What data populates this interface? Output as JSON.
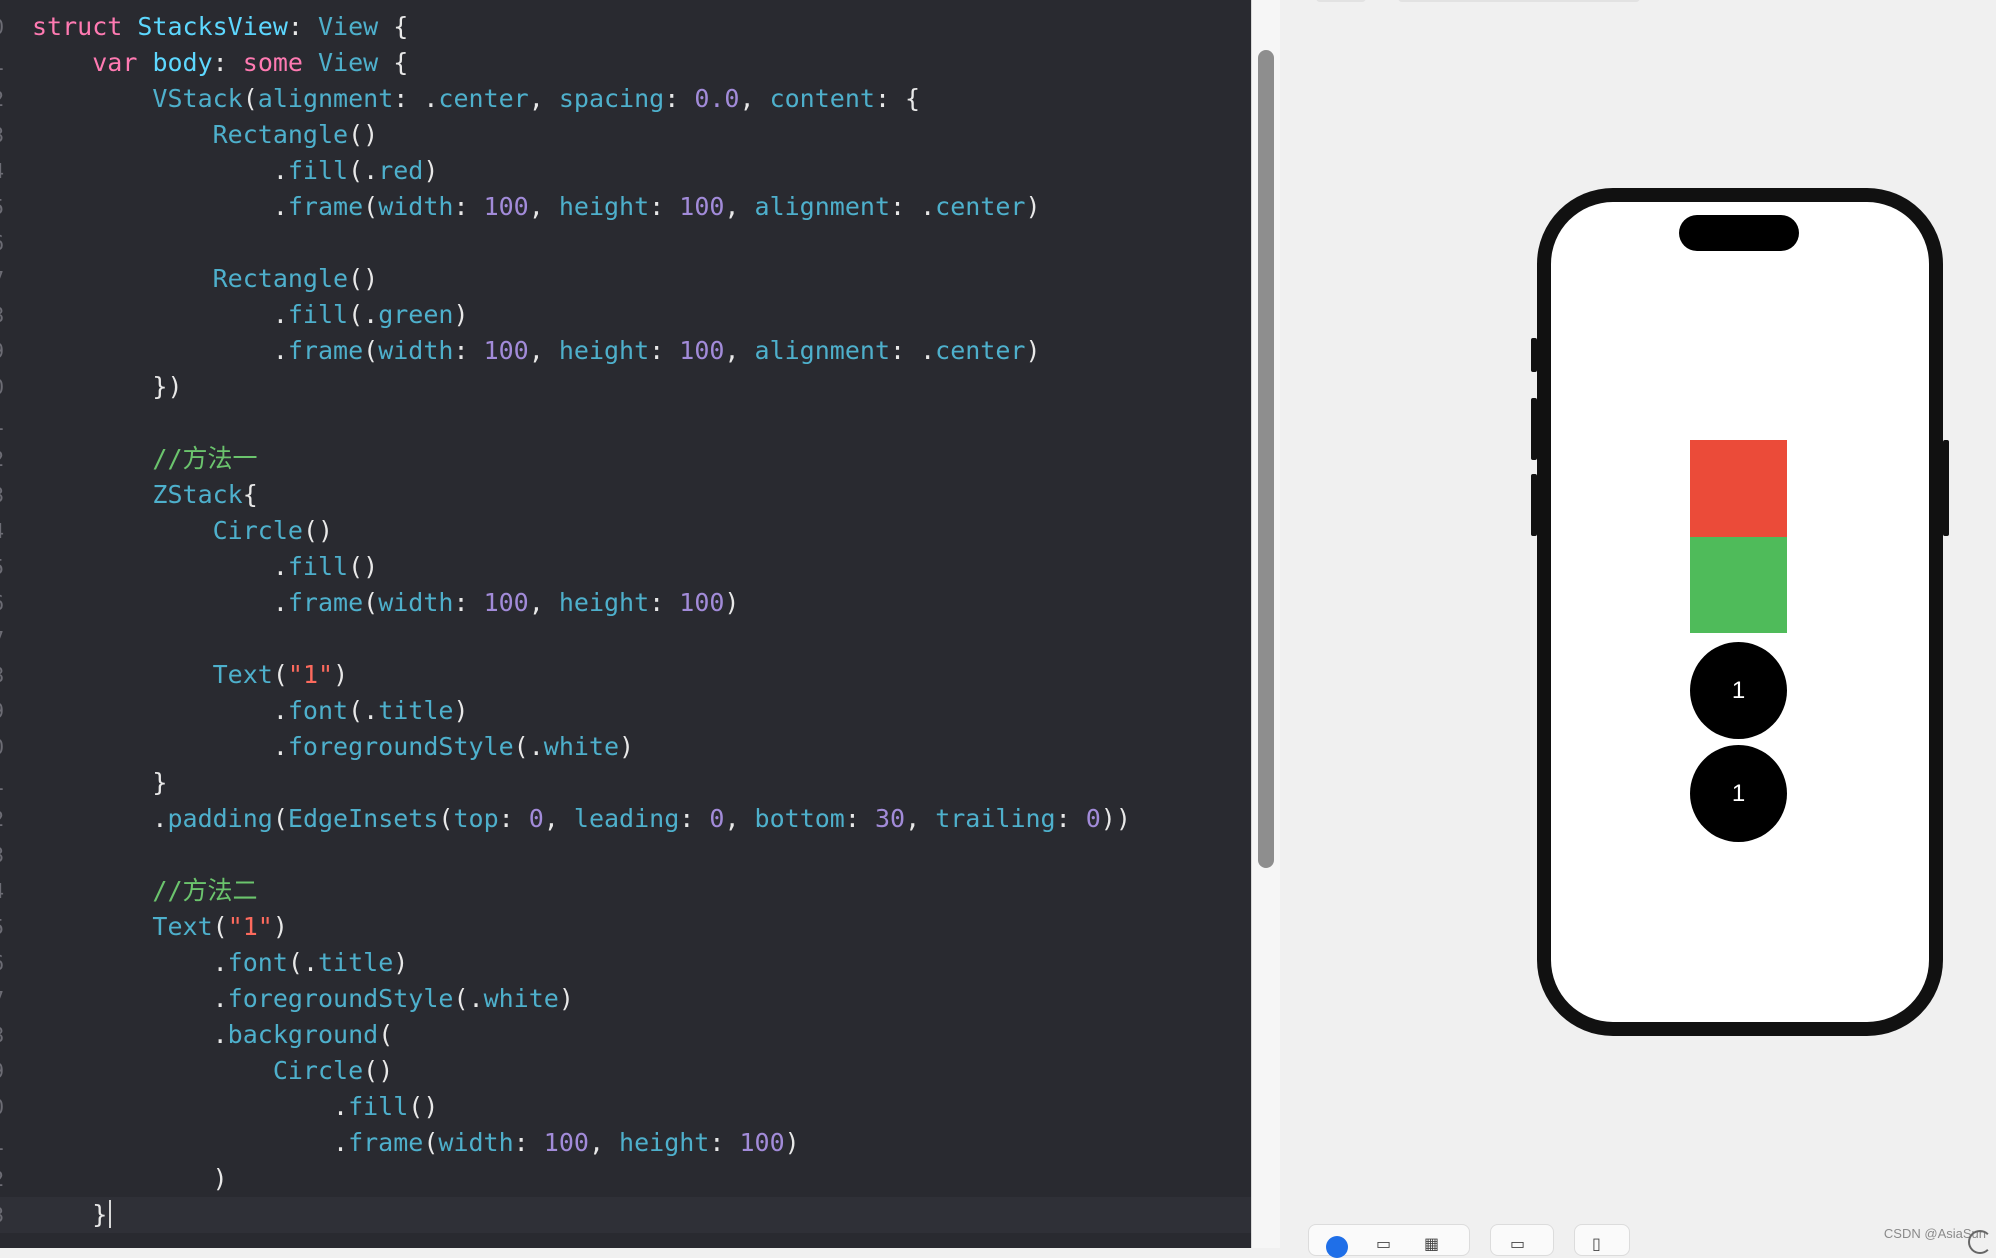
{
  "editor": {
    "lines": [
      [
        [
          "kw",
          "struct "
        ],
        [
          "ty2",
          "StacksView"
        ],
        [
          "pl",
          ": "
        ],
        [
          "fn",
          "View"
        ],
        [
          "pl",
          " {"
        ]
      ],
      [
        [
          "pl",
          "    "
        ],
        [
          "kw",
          "var "
        ],
        [
          "ty2",
          "body"
        ],
        [
          "pl",
          ": "
        ],
        [
          "kw",
          "some "
        ],
        [
          "fn",
          "View"
        ],
        [
          "pl",
          " {"
        ]
      ],
      [
        [
          "pl",
          "        "
        ],
        [
          "fn",
          "VStack"
        ],
        [
          "pl",
          "("
        ],
        [
          "fn",
          "alignment"
        ],
        [
          "pl",
          ": ."
        ],
        [
          "fn",
          "center"
        ],
        [
          "pl",
          ", "
        ],
        [
          "fn",
          "spacing"
        ],
        [
          "pl",
          ": "
        ],
        [
          "num",
          "0.0"
        ],
        [
          "pl",
          ", "
        ],
        [
          "fn",
          "content"
        ],
        [
          "pl",
          ": {"
        ]
      ],
      [
        [
          "pl",
          "            "
        ],
        [
          "fn",
          "Rectangle"
        ],
        [
          "pl",
          "()"
        ]
      ],
      [
        [
          "pl",
          "                ."
        ],
        [
          "fn",
          "fill"
        ],
        [
          "pl",
          "(."
        ],
        [
          "fn",
          "red"
        ],
        [
          "pl",
          ")"
        ]
      ],
      [
        [
          "pl",
          "                ."
        ],
        [
          "fn",
          "frame"
        ],
        [
          "pl",
          "("
        ],
        [
          "fn",
          "width"
        ],
        [
          "pl",
          ": "
        ],
        [
          "num",
          "100"
        ],
        [
          "pl",
          ", "
        ],
        [
          "fn",
          "height"
        ],
        [
          "pl",
          ": "
        ],
        [
          "num",
          "100"
        ],
        [
          "pl",
          ", "
        ],
        [
          "fn",
          "alignment"
        ],
        [
          "pl",
          ": ."
        ],
        [
          "fn",
          "center"
        ],
        [
          "pl",
          ")"
        ]
      ],
      [
        [
          "pl",
          ""
        ]
      ],
      [
        [
          "pl",
          "            "
        ],
        [
          "fn",
          "Rectangle"
        ],
        [
          "pl",
          "()"
        ]
      ],
      [
        [
          "pl",
          "                ."
        ],
        [
          "fn",
          "fill"
        ],
        [
          "pl",
          "(."
        ],
        [
          "fn",
          "green"
        ],
        [
          "pl",
          ")"
        ]
      ],
      [
        [
          "pl",
          "                ."
        ],
        [
          "fn",
          "frame"
        ],
        [
          "pl",
          "("
        ],
        [
          "fn",
          "width"
        ],
        [
          "pl",
          ": "
        ],
        [
          "num",
          "100"
        ],
        [
          "pl",
          ", "
        ],
        [
          "fn",
          "height"
        ],
        [
          "pl",
          ": "
        ],
        [
          "num",
          "100"
        ],
        [
          "pl",
          ", "
        ],
        [
          "fn",
          "alignment"
        ],
        [
          "pl",
          ": ."
        ],
        [
          "fn",
          "center"
        ],
        [
          "pl",
          ")"
        ]
      ],
      [
        [
          "pl",
          "        })"
        ]
      ],
      [
        [
          "pl",
          ""
        ]
      ],
      [
        [
          "pl",
          "        "
        ],
        [
          "cm",
          "//方法一"
        ]
      ],
      [
        [
          "pl",
          "        "
        ],
        [
          "fn",
          "ZStack"
        ],
        [
          "pl",
          "{"
        ]
      ],
      [
        [
          "pl",
          "            "
        ],
        [
          "fn",
          "Circle"
        ],
        [
          "pl",
          "()"
        ]
      ],
      [
        [
          "pl",
          "                ."
        ],
        [
          "fn",
          "fill"
        ],
        [
          "pl",
          "()"
        ]
      ],
      [
        [
          "pl",
          "                ."
        ],
        [
          "fn",
          "frame"
        ],
        [
          "pl",
          "("
        ],
        [
          "fn",
          "width"
        ],
        [
          "pl",
          ": "
        ],
        [
          "num",
          "100"
        ],
        [
          "pl",
          ", "
        ],
        [
          "fn",
          "height"
        ],
        [
          "pl",
          ": "
        ],
        [
          "num",
          "100"
        ],
        [
          "pl",
          ")"
        ]
      ],
      [
        [
          "pl",
          ""
        ]
      ],
      [
        [
          "pl",
          "            "
        ],
        [
          "fn",
          "Text"
        ],
        [
          "pl",
          "("
        ],
        [
          "str",
          "\"1\""
        ],
        [
          "pl",
          ")"
        ]
      ],
      [
        [
          "pl",
          "                ."
        ],
        [
          "fn",
          "font"
        ],
        [
          "pl",
          "(."
        ],
        [
          "fn",
          "title"
        ],
        [
          "pl",
          ")"
        ]
      ],
      [
        [
          "pl",
          "                ."
        ],
        [
          "fn",
          "foregroundStyle"
        ],
        [
          "pl",
          "(."
        ],
        [
          "fn",
          "white"
        ],
        [
          "pl",
          ")"
        ]
      ],
      [
        [
          "pl",
          "        }"
        ]
      ],
      [
        [
          "pl",
          "        ."
        ],
        [
          "fn",
          "padding"
        ],
        [
          "pl",
          "("
        ],
        [
          "fn",
          "EdgeInsets"
        ],
        [
          "pl",
          "("
        ],
        [
          "fn",
          "top"
        ],
        [
          "pl",
          ": "
        ],
        [
          "num",
          "0"
        ],
        [
          "pl",
          ", "
        ],
        [
          "fn",
          "leading"
        ],
        [
          "pl",
          ": "
        ],
        [
          "num",
          "0"
        ],
        [
          "pl",
          ", "
        ],
        [
          "fn",
          "bottom"
        ],
        [
          "pl",
          ": "
        ],
        [
          "num",
          "30"
        ],
        [
          "pl",
          ", "
        ],
        [
          "fn",
          "trailing"
        ],
        [
          "pl",
          ": "
        ],
        [
          "num",
          "0"
        ],
        [
          "pl",
          "))"
        ]
      ],
      [
        [
          "pl",
          ""
        ]
      ],
      [
        [
          "pl",
          "        "
        ],
        [
          "cm",
          "//方法二"
        ]
      ],
      [
        [
          "pl",
          "        "
        ],
        [
          "fn",
          "Text"
        ],
        [
          "pl",
          "("
        ],
        [
          "str",
          "\"1\""
        ],
        [
          "pl",
          ")"
        ]
      ],
      [
        [
          "pl",
          "            ."
        ],
        [
          "fn",
          "font"
        ],
        [
          "pl",
          "(."
        ],
        [
          "fn",
          "title"
        ],
        [
          "pl",
          ")"
        ]
      ],
      [
        [
          "pl",
          "            ."
        ],
        [
          "fn",
          "foregroundStyle"
        ],
        [
          "pl",
          "(."
        ],
        [
          "fn",
          "white"
        ],
        [
          "pl",
          ")"
        ]
      ],
      [
        [
          "pl",
          "            ."
        ],
        [
          "fn",
          "background"
        ],
        [
          "pl",
          "("
        ]
      ],
      [
        [
          "pl",
          "                "
        ],
        [
          "fn",
          "Circle"
        ],
        [
          "pl",
          "()"
        ]
      ],
      [
        [
          "pl",
          "                    ."
        ],
        [
          "fn",
          "fill"
        ],
        [
          "pl",
          "()"
        ]
      ],
      [
        [
          "pl",
          "                    ."
        ],
        [
          "fn",
          "frame"
        ],
        [
          "pl",
          "("
        ],
        [
          "fn",
          "width"
        ],
        [
          "pl",
          ": "
        ],
        [
          "num",
          "100"
        ],
        [
          "pl",
          ", "
        ],
        [
          "fn",
          "height"
        ],
        [
          "pl",
          ": "
        ],
        [
          "num",
          "100"
        ],
        [
          "pl",
          ")"
        ]
      ],
      [
        [
          "pl",
          "            )"
        ]
      ],
      [
        [
          "pl",
          "    }"
        ]
      ]
    ],
    "current_line_index": 33
  },
  "preview": {
    "circle1_text": "1",
    "circle2_text": "1",
    "colors": {
      "red_rect": "#eb4b39",
      "green_rect": "#4fbb5a",
      "circle": "#000000",
      "editor_bg": "#292a30"
    }
  },
  "toolbar": {
    "icons": [
      "live-preview-icon",
      "play-icon",
      "grid-icon",
      "variant-icon",
      "device-icon"
    ]
  },
  "watermark": "CSDN @AsiaSun"
}
